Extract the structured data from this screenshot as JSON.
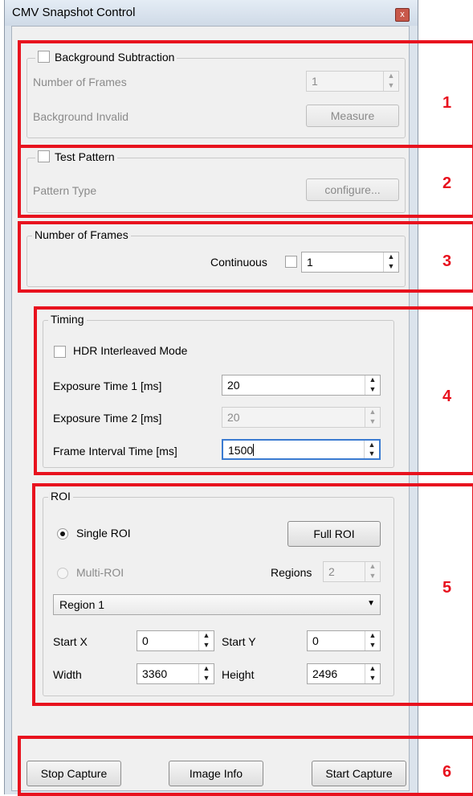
{
  "window": {
    "title": "CMV Snapshot Control",
    "close_glyph": "x"
  },
  "background_subtraction": {
    "title": "Background Subtraction",
    "frames_label": "Number of Frames",
    "frames_value": "1",
    "status_label": "Background Invalid",
    "measure_button": "Measure"
  },
  "test_pattern": {
    "title": "Test Pattern",
    "pattern_label": "Pattern Type",
    "configure_button": "configure..."
  },
  "number_of_frames": {
    "title": "Number of Frames",
    "continuous_label": "Continuous",
    "value": "1"
  },
  "timing": {
    "title": "Timing",
    "hdr_label": "HDR Interleaved Mode",
    "exposure1_label": "Exposure Time 1 [ms]",
    "exposure1_value": "20",
    "exposure2_label": "Exposure Time 2 [ms]",
    "exposure2_value": "20",
    "interval_label": "Frame Interval Time [ms]",
    "interval_value": "1500"
  },
  "roi": {
    "title": "ROI",
    "single_label": "Single ROI",
    "multi_label": "Multi-ROI",
    "full_roi_button": "Full ROI",
    "regions_label": "Regions",
    "regions_value": "2",
    "region_select": "Region 1",
    "start_x_label": "Start X",
    "start_x_value": "0",
    "start_y_label": "Start Y",
    "start_y_value": "0",
    "width_label": "Width",
    "width_value": "3360",
    "height_label": "Height",
    "height_value": "2496"
  },
  "actions": {
    "stop_capture": "Stop Capture",
    "image_info": "Image Info",
    "start_capture": "Start Capture"
  },
  "annotations": {
    "n1": "1",
    "n2": "2",
    "n3": "3",
    "n4": "4",
    "n5": "5",
    "n6": "6"
  },
  "colors": {
    "annotation": "#e8121e",
    "focus": "#3b7bd1"
  }
}
